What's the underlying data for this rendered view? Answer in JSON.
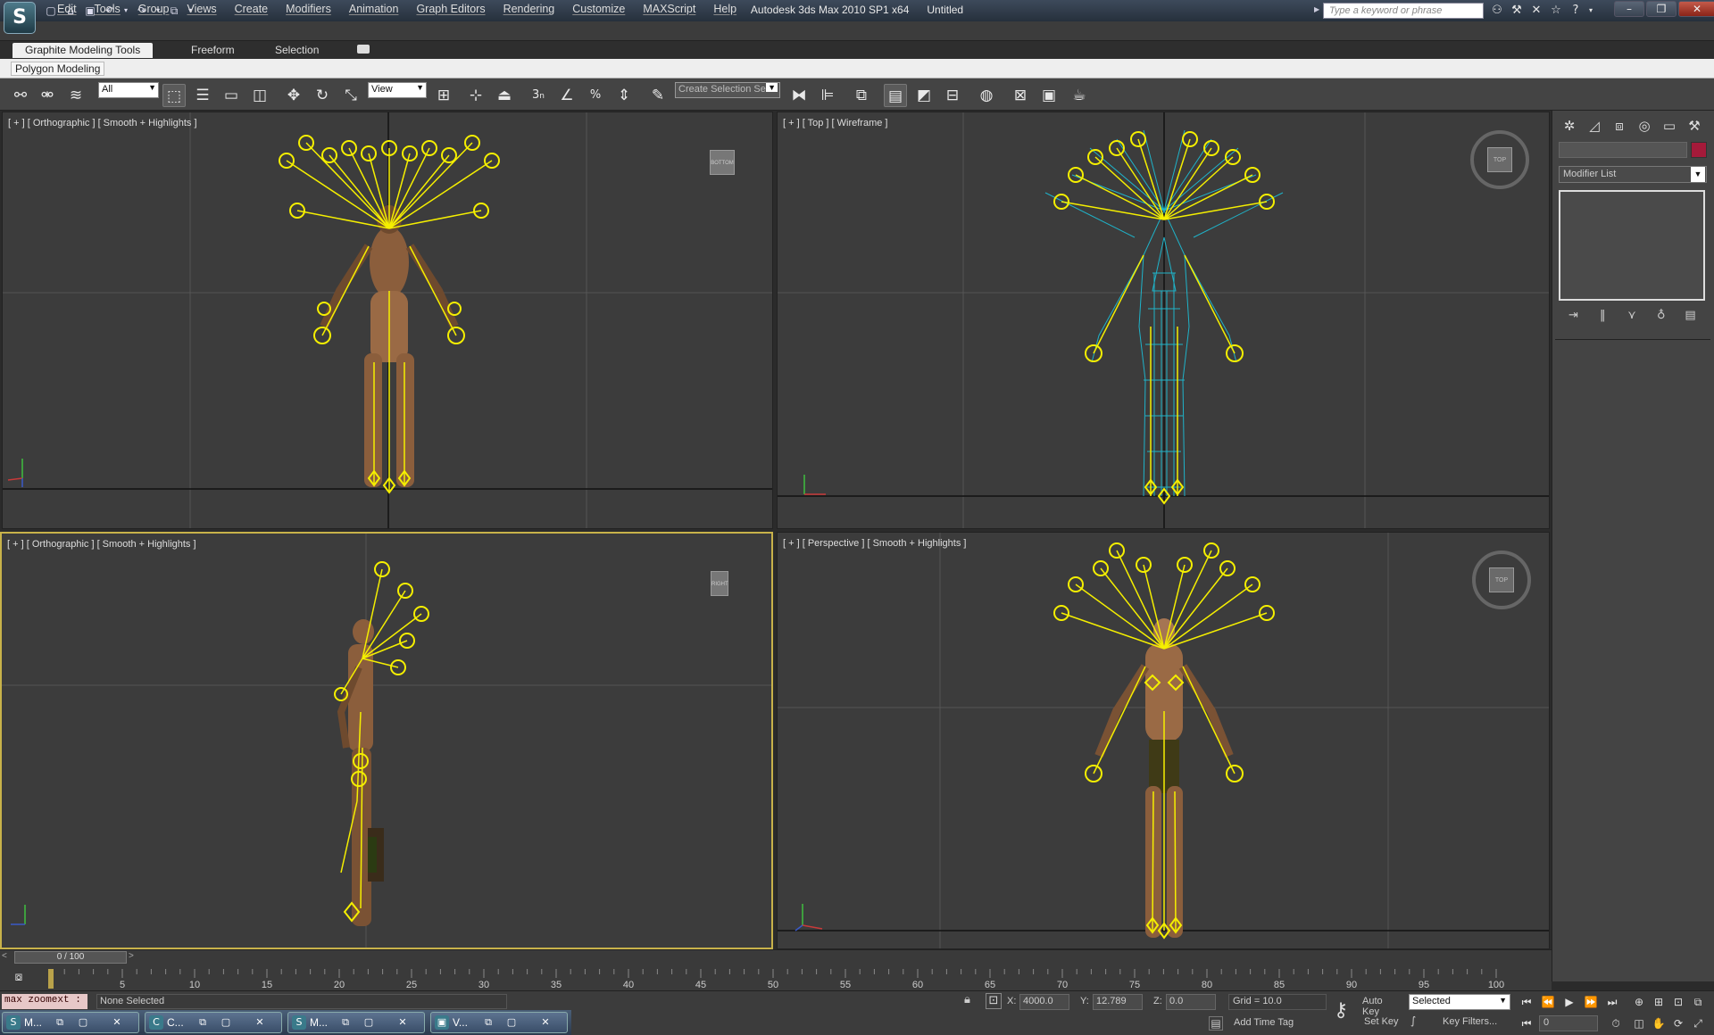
{
  "app": {
    "title": "Autodesk 3ds Max  2010 SP1 x64",
    "document": "Untitled",
    "logo_glyph": "S"
  },
  "search": {
    "placeholder": "Type a keyword or phrase"
  },
  "menu": [
    "Edit",
    "Tools",
    "Group",
    "Views",
    "Create",
    "Modifiers",
    "Animation",
    "Graph Editors",
    "Rendering",
    "Customize",
    "MAXScript",
    "Help"
  ],
  "ribbon": {
    "tabs": [
      "Graphite Modeling Tools",
      "Freeform",
      "Selection"
    ],
    "panel_label": "Polygon Modeling"
  },
  "toolbar": {
    "selection_filter": "All",
    "ref_coord": "View",
    "named_selection": "Create Selection Se",
    "snap_3": "3",
    "snap_n": "n",
    "pct": "%"
  },
  "viewports": {
    "top_left": {
      "label": "[ + ] [ Orthographic ] [ Smooth + Highlights ]",
      "cube_label": "BOTTOM"
    },
    "top_right": {
      "label": "[ + ] [ Top ] [ Wireframe ]",
      "cube_label": "TOP"
    },
    "bottom_left": {
      "label": "[ + ] [ Orthographic ] [ Smooth + Highlights ]",
      "cube_label": "RIGHT"
    },
    "bottom_right": {
      "label": "[ + ] [ Perspective ] [ Smooth + Highlights ]",
      "cube_label": "TOP"
    }
  },
  "command_panel": {
    "modifier_list": "Modifier List",
    "object_color": "#a51a3a"
  },
  "timeline": {
    "slider_text": "0 / 100",
    "ticks": [
      "5",
      "10",
      "15",
      "20",
      "25",
      "30",
      "35",
      "40",
      "45",
      "50",
      "55",
      "60",
      "65",
      "70",
      "75",
      "80",
      "85",
      "90",
      "95",
      "100"
    ]
  },
  "status": {
    "maxscript": "max zoomext :",
    "message": "None Selected",
    "x_label": "X:",
    "x_value": "4000.0",
    "y_label": "Y:",
    "y_value": "12.789",
    "z_label": "Z:",
    "z_value": "0.0",
    "grid": "Grid = 10.0",
    "add_time_tag": "Add Time Tag",
    "auto_key": "Auto Key",
    "set_key": "Set Key",
    "key_mode": "Selected",
    "key_filters": "Key Filters...",
    "frame": "0"
  },
  "taskbar": [
    {
      "label": "M..."
    },
    {
      "label": "C..."
    },
    {
      "label": "M..."
    },
    {
      "label": "V..."
    }
  ],
  "colors": {
    "bone_yellow": "#f5ef00",
    "wire_cyan": "#1fb3c9",
    "skin": "#9a6a45",
    "active_border": "#c8b24a"
  }
}
